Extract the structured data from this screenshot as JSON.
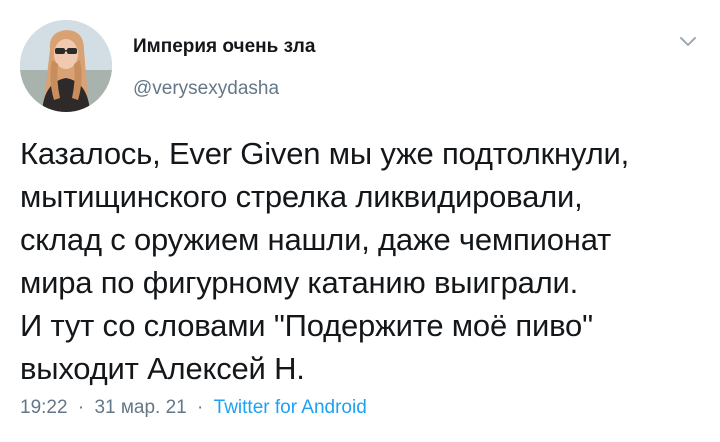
{
  "author": {
    "display_name": "Империя очень зла",
    "username": "@verysexydasha"
  },
  "tweet": {
    "lines": [
      "Казалось, Ever Given мы уже подтолкнули,",
      "мытищинского стрелка ликвидировали,",
      "склад с оружием нашли, даже чемпионат",
      "мира по фигурному катанию выиграли.",
      "И тут со словами \"Подержите моё пиво\"",
      "выходит Алексей Н."
    ]
  },
  "meta": {
    "time": "19:22",
    "date": "31 мар. 21",
    "separator": "·",
    "source": "Twitter for Android"
  },
  "icons": {
    "menu": "chevron-down-icon"
  },
  "colors": {
    "text": "#14171a",
    "secondary": "#657786",
    "link": "#1da1f2"
  }
}
